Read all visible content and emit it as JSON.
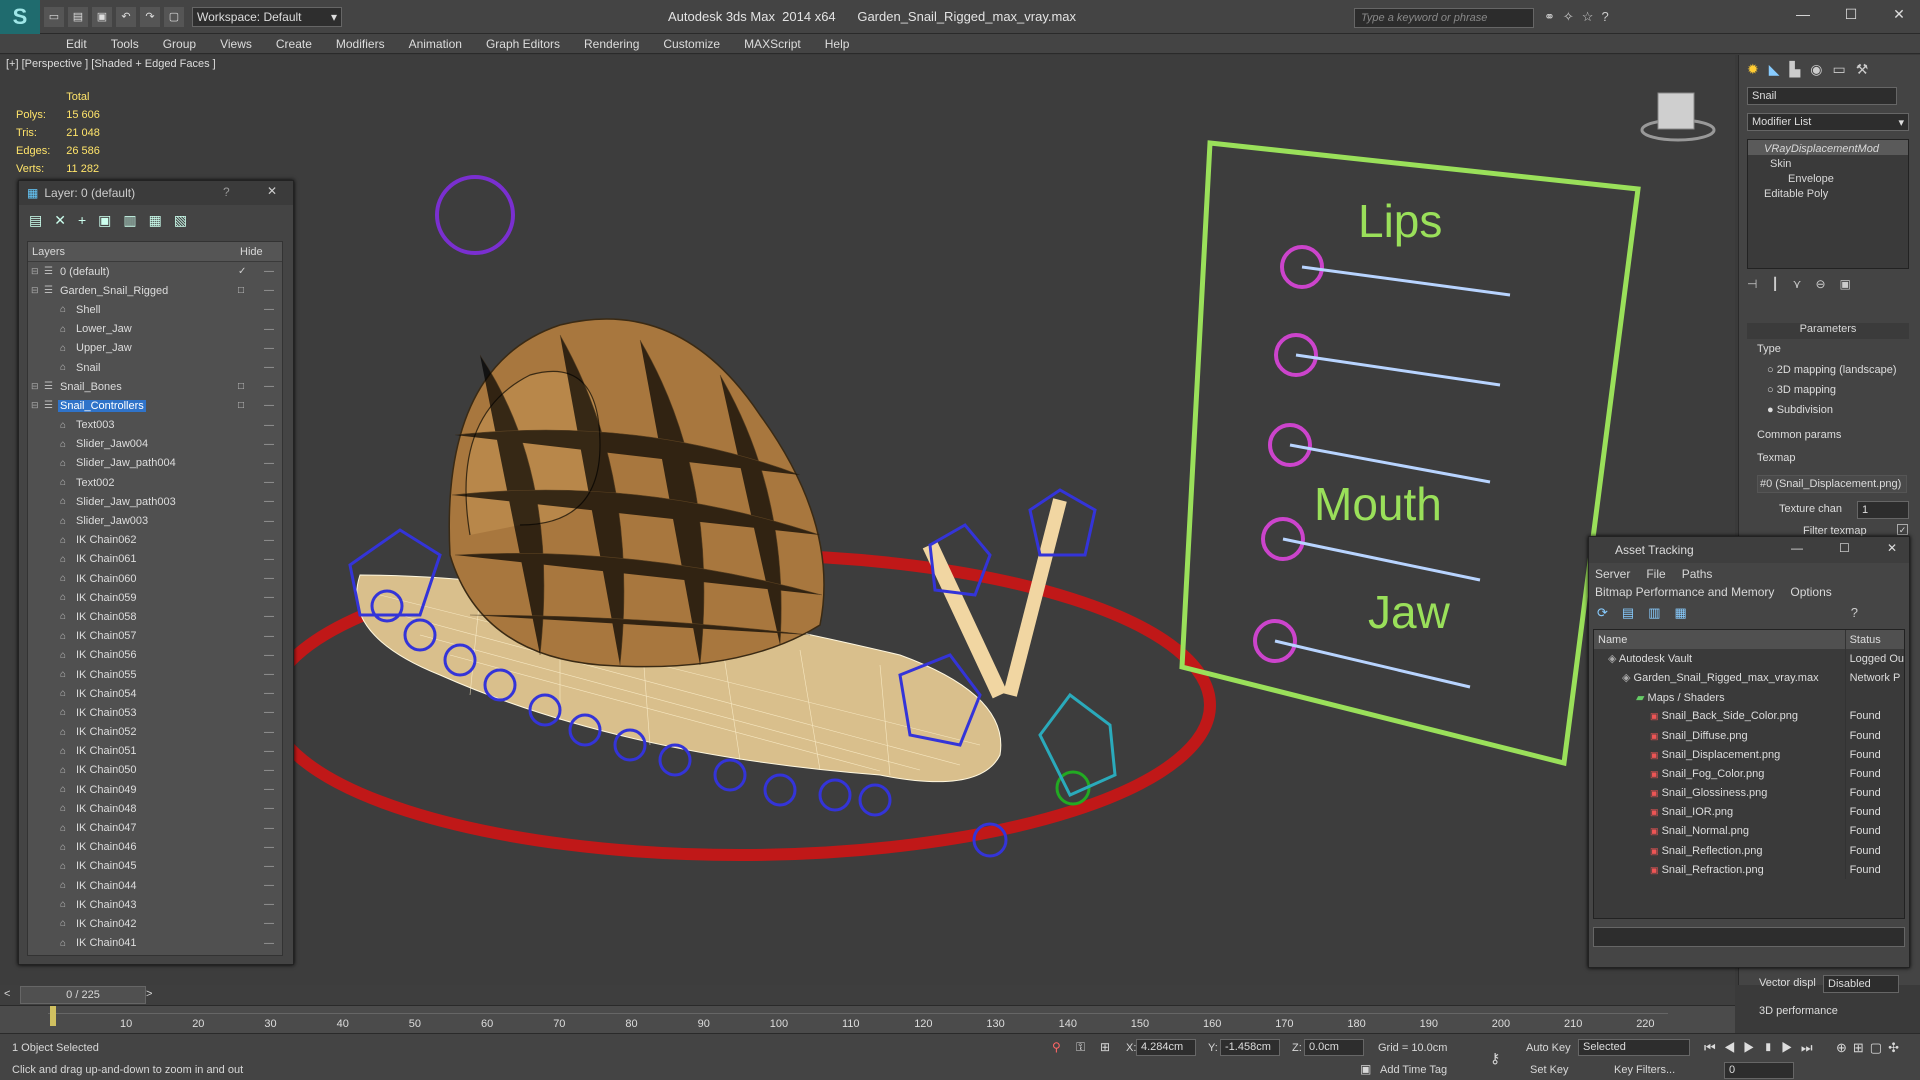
{
  "app": {
    "title": "Autodesk 3ds Max  2014 x64      Garden_Snail_Rigged_max_vray.max",
    "workspace": "Workspace: Default",
    "search_placeholder": "Type a keyword or phrase"
  },
  "menu": [
    "Edit",
    "Tools",
    "Group",
    "Views",
    "Create",
    "Modifiers",
    "Animation",
    "Graph Editors",
    "Rendering",
    "Customize",
    "MAXScript",
    "Help"
  ],
  "viewport": {
    "label": "[+] [Perspective ] [Shaded + Edged Faces ]",
    "stats_total": "Total",
    "stats": [
      {
        "k": "Polys:",
        "v": "15 606"
      },
      {
        "k": "Tris:",
        "v": "21 048"
      },
      {
        "k": "Edges:",
        "v": "26 586"
      },
      {
        "k": "Verts:",
        "v": "11 282"
      }
    ],
    "board_texts": [
      "Lips",
      "Mouth",
      "Jaw"
    ]
  },
  "layer_dialog": {
    "title": "Layer: 0 (default)",
    "col_layers": "Layers",
    "col_hide": "Hide",
    "rows": [
      {
        "name": "0 (default)",
        "level": 0,
        "check": "✓"
      },
      {
        "name": "Garden_Snail_Rigged",
        "level": 0,
        "check": "□"
      },
      {
        "name": "Shell",
        "level": 1
      },
      {
        "name": "Lower_Jaw",
        "level": 1
      },
      {
        "name": "Upper_Jaw",
        "level": 1
      },
      {
        "name": "Snail",
        "level": 1
      },
      {
        "name": "Snail_Bones",
        "level": 0,
        "check": "□"
      },
      {
        "name": "Snail_Controllers",
        "level": 0,
        "check": "□",
        "selected": true
      },
      {
        "name": "Text003",
        "level": 1
      },
      {
        "name": "Slider_Jaw004",
        "level": 1
      },
      {
        "name": "Slider_Jaw_path004",
        "level": 1
      },
      {
        "name": "Text002",
        "level": 1
      },
      {
        "name": "Slider_Jaw_path003",
        "level": 1
      },
      {
        "name": "Slider_Jaw003",
        "level": 1
      },
      {
        "name": "IK Chain062",
        "level": 1
      },
      {
        "name": "IK Chain061",
        "level": 1
      },
      {
        "name": "IK Chain060",
        "level": 1
      },
      {
        "name": "IK Chain059",
        "level": 1
      },
      {
        "name": "IK Chain058",
        "level": 1
      },
      {
        "name": "IK Chain057",
        "level": 1
      },
      {
        "name": "IK Chain056",
        "level": 1
      },
      {
        "name": "IK Chain055",
        "level": 1
      },
      {
        "name": "IK Chain054",
        "level": 1
      },
      {
        "name": "IK Chain053",
        "level": 1
      },
      {
        "name": "IK Chain052",
        "level": 1
      },
      {
        "name": "IK Chain051",
        "level": 1
      },
      {
        "name": "IK Chain050",
        "level": 1
      },
      {
        "name": "IK Chain049",
        "level": 1
      },
      {
        "name": "IK Chain048",
        "level": 1
      },
      {
        "name": "IK Chain047",
        "level": 1
      },
      {
        "name": "IK Chain046",
        "level": 1
      },
      {
        "name": "IK Chain045",
        "level": 1
      },
      {
        "name": "IK Chain044",
        "level": 1
      },
      {
        "name": "IK Chain043",
        "level": 1
      },
      {
        "name": "IK Chain042",
        "level": 1
      },
      {
        "name": "IK Chain041",
        "level": 1
      }
    ]
  },
  "command_panel": {
    "object_name": "Snail",
    "modifier_list": "Modifier List",
    "stack": [
      "VRayDisplacementMod",
      "Skin",
      "Envelope",
      "Editable Poly"
    ],
    "params_title": "Parameters",
    "type_label": "Type",
    "type_options": [
      "2D mapping (landscape)",
      "3D mapping",
      "Subdivision"
    ],
    "common_params": "Common params",
    "texmap_label": "Texmap",
    "texmap_value": "#0 (Snail_Displacement.png)",
    "texture_chan_label": "Texture chan",
    "texture_chan_value": "1",
    "filter_texmap": "Filter texmap",
    "vector_disp_label": "Vector displ",
    "vector_disp_value": "Disabled",
    "perf_label": "3D performance"
  },
  "asset_tracking": {
    "title": "Asset Tracking",
    "menu": [
      "Server",
      "File",
      "Paths"
    ],
    "menu2": [
      "Bitmap Performance and Memory",
      "Options"
    ],
    "col_name": "Name",
    "col_status": "Status",
    "rows": [
      {
        "name": "Autodesk Vault",
        "status": "Logged Ou",
        "indent": 1
      },
      {
        "name": "Garden_Snail_Rigged_max_vray.max",
        "status": "Network P",
        "indent": 2
      },
      {
        "name": "Maps / Shaders",
        "status": "",
        "indent": 3
      },
      {
        "name": "Snail_Back_Side_Color.png",
        "status": "Found",
        "indent": 4
      },
      {
        "name": "Snail_Diffuse.png",
        "status": "Found",
        "indent": 4
      },
      {
        "name": "Snail_Displacement.png",
        "status": "Found",
        "indent": 4
      },
      {
        "name": "Snail_Fog_Color.png",
        "status": "Found",
        "indent": 4
      },
      {
        "name": "Snail_Glossiness.png",
        "status": "Found",
        "indent": 4
      },
      {
        "name": "Snail_IOR.png",
        "status": "Found",
        "indent": 4
      },
      {
        "name": "Snail_Normal.png",
        "status": "Found",
        "indent": 4
      },
      {
        "name": "Snail_Reflection.png",
        "status": "Found",
        "indent": 4
      },
      {
        "name": "Snail_Refraction.png",
        "status": "Found",
        "indent": 4
      }
    ]
  },
  "timeline": {
    "frame": "0 / 225",
    "ticks": [
      "10",
      "20",
      "30",
      "40",
      "50",
      "60",
      "70",
      "80",
      "90",
      "100",
      "110",
      "120",
      "130",
      "140",
      "150",
      "160",
      "170",
      "180",
      "190",
      "200",
      "210",
      "220"
    ]
  },
  "status": {
    "selection": "1 Object Selected",
    "hint": "Click and drag up-and-down to zoom in and out",
    "x_label": "X:",
    "x_value": "4.284cm",
    "y_label": "Y:",
    "y_value": "-1.458cm",
    "z_label": "Z:",
    "z_value": "0.0cm",
    "grid": "Grid = 10.0cm",
    "add_time_tag": "Add Time Tag",
    "auto_key": "Auto Key",
    "set_key": "Set Key",
    "selected": "Selected",
    "key_filters": "Key Filters...",
    "frame_field": "0"
  },
  "colors": {
    "accent": "#2f73c9",
    "ring": "#cc2222",
    "board": "#9ae05a",
    "controllers": "#3a3ad8",
    "yellow_stats": "#ffe46a"
  }
}
